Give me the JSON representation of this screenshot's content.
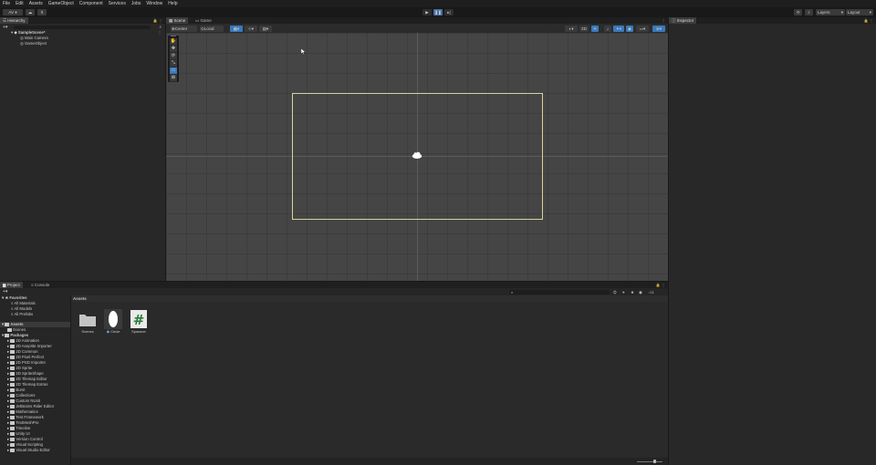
{
  "menu": [
    "File",
    "Edit",
    "Assets",
    "GameObject",
    "Component",
    "Services",
    "Jobs",
    "Window",
    "Help"
  ],
  "toolbar": {
    "account": "AV ▾",
    "layers": "Layers",
    "layout": "Layout"
  },
  "hierarchy": {
    "tab": "Hierarchy",
    "scene": "SampleScene*",
    "items": [
      "Main Camera",
      "GameObject"
    ]
  },
  "scene": {
    "tabs": [
      "Scene",
      "Game"
    ],
    "pivot": "Center",
    "space": "Local"
  },
  "inspector": {
    "tab": "Inspector"
  },
  "project": {
    "tabs": [
      "Project",
      "Console"
    ],
    "favorites": {
      "label": "Favorites",
      "items": [
        "All Materials",
        "All Models",
        "All Prefabs"
      ]
    },
    "assets_root": {
      "label": "Assets",
      "items": [
        "Scenes"
      ]
    },
    "packages": {
      "label": "Packages",
      "items": [
        "2D Animation",
        "2D Aseprite Importer",
        "2D Common",
        "2D Pixel Perfect",
        "2D PSD Importer",
        "2D Sprite",
        "2D SpriteShape",
        "2D Tilemap Editor",
        "2D Tilemap Extras",
        "Burst",
        "Collections",
        "Custom NUnit",
        "JetBrains Rider Editor",
        "Mathematics",
        "Test Framework",
        "TextMeshPro",
        "Timeline",
        "Unity UI",
        "Version Control",
        "Visual Scripting",
        "Visual Studio Editor"
      ]
    },
    "breadcrumb": "Assets",
    "assets": [
      {
        "name": "Scenes",
        "type": "folder"
      },
      {
        "name": "Circle",
        "type": "sprite"
      },
      {
        "name": "Spawner",
        "type": "script"
      }
    ],
    "count": "21"
  },
  "colors": {
    "accent": "#3a79bb",
    "play_active": "#4a6fa5"
  }
}
